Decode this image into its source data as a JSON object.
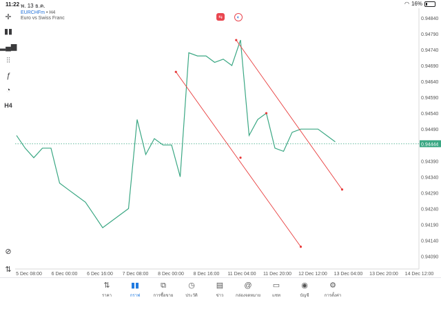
{
  "status_bar": {
    "time": "11:22",
    "date": "พ. 13 ธ.ค.",
    "battery": "16%",
    "battery_level": 0.16
  },
  "symbol": {
    "name": "EURCHFm",
    "separator": "•",
    "timeframe": "H4",
    "description": "Euro vs Swiss Franc"
  },
  "left_toolbar": {
    "timeframe_label": "H4",
    "icons": [
      "crosshair-icon",
      "candles-icon",
      "volume-bars-icon",
      "indicators-icon",
      "function-icon",
      "objects-icon",
      "timeframe-icon",
      "zoom-icon",
      "trade-icon"
    ]
  },
  "colors": {
    "line": "#3aa783",
    "channel": "#e83b3b",
    "price_label_bg": "#3aa783",
    "accent": "#1f7ae0"
  },
  "chart_data": {
    "type": "line",
    "x": [
      "5 Dec 08:00",
      "6 Dec 00:00",
      "6 Dec 16:00",
      "7 Dec 08:00",
      "8 Dec 00:00",
      "8 Dec 16:00",
      "11 Dec 04:00",
      "11 Dec 20:00",
      "12 Dec 12:00",
      "13 Dec 04:00",
      "13 Dec 20:00",
      "14 Dec 12:00"
    ],
    "price_ticks": [
      "0.94840",
      "0.94790",
      "0.94740",
      "0.94690",
      "0.94640",
      "0.94590",
      "0.94540",
      "0.94490",
      "0.94390",
      "0.94340",
      "0.94290",
      "0.94240",
      "0.94190",
      "0.94140",
      "0.94090"
    ],
    "current_price": "0.94444",
    "ylim": [
      0.9405,
      0.9487
    ],
    "series": [
      {
        "values": [
          0.9447,
          0.9443,
          0.944,
          0.9443,
          0.9443,
          0.9432,
          0.943,
          0.9428,
          0.9426,
          0.9422,
          0.9418,
          0.942,
          0.9422,
          0.9424,
          0.9452,
          0.9441,
          0.9446,
          0.9444,
          0.9444,
          0.9434,
          0.9473,
          0.9472,
          0.9472,
          0.947,
          0.9471,
          0.9469,
          0.9477,
          0.9447,
          0.9452,
          0.9454,
          0.9443,
          0.9442,
          0.9448,
          0.9449,
          0.9449,
          0.9449,
          0.9447,
          0.9445
        ]
      }
    ],
    "channel_lines": [
      {
        "from": [
          18.5,
          0.9467
        ],
        "to": [
          33.0,
          0.9412
        ]
      },
      {
        "from": [
          25.5,
          0.9477
        ],
        "to": [
          37.8,
          0.943
        ]
      }
    ],
    "channel_midpoints": [
      [
        26.0,
        0.944
      ],
      [
        29.0,
        0.9454
      ]
    ]
  },
  "tabs": [
    {
      "label": "ราคา",
      "icon": "quotes-icon",
      "active": false
    },
    {
      "label": "กราฟ",
      "icon": "chart-icon",
      "active": true
    },
    {
      "label": "การซื้อขาย",
      "icon": "trade-tab-icon",
      "active": false
    },
    {
      "label": "ประวัติ",
      "icon": "history-icon",
      "active": false
    },
    {
      "label": "ข่าว",
      "icon": "news-icon",
      "active": false
    },
    {
      "label": "กล่องจดหมาย",
      "icon": "mailbox-icon",
      "active": false
    },
    {
      "label": "แชท",
      "icon": "chat-icon",
      "active": false
    },
    {
      "label": "บัญชี",
      "icon": "account-icon",
      "active": false
    },
    {
      "label": "การตั้งค่า",
      "icon": "settings-icon",
      "active": false
    }
  ]
}
